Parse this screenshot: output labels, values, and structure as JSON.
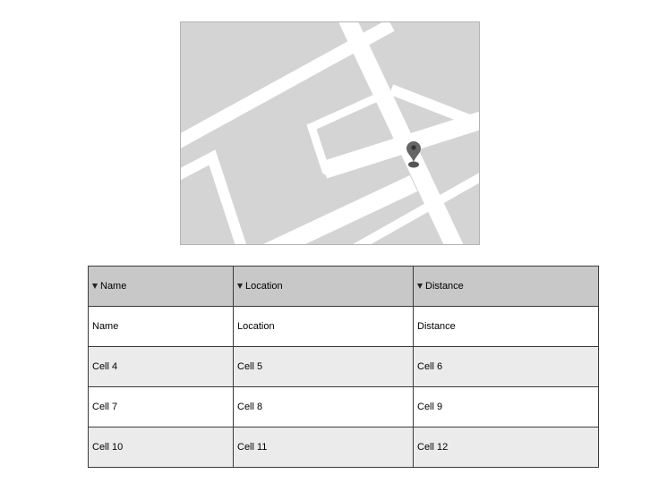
{
  "map": {
    "background_color": "#d4d4d4",
    "road_color": "#ffffff",
    "marker_color": "#666666",
    "marker_icon": "map-pin-icon"
  },
  "table": {
    "header_color": "#c8c8c8",
    "alt_row_color": "#ebebeb",
    "sort_icon": "sort-down-triangle-icon",
    "columns": [
      "Name",
      "Location",
      "Distance"
    ],
    "rows": [
      [
        "Name",
        "Location",
        "Distance"
      ],
      [
        "Cell 4",
        "Cell 5",
        "Cell 6"
      ],
      [
        "Cell 7",
        "Cell 8",
        "Cell 9"
      ],
      [
        "Cell 10",
        "Cell 11",
        "Cell 12"
      ]
    ]
  }
}
